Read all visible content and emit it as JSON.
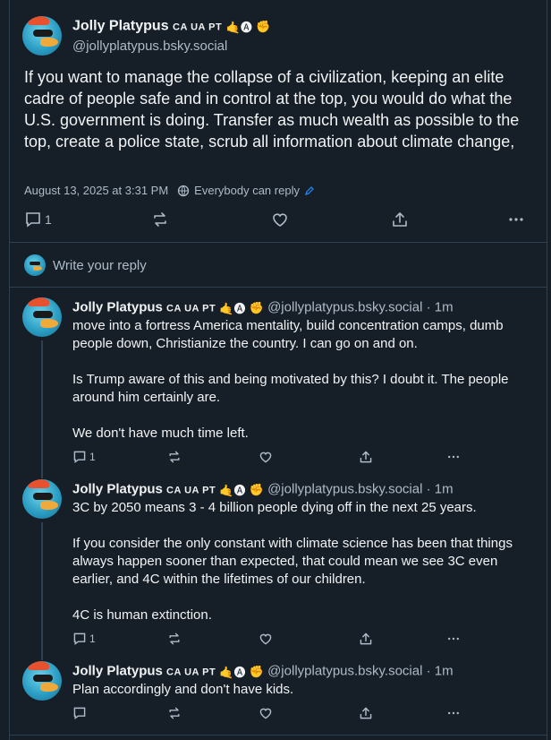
{
  "post": {
    "author_name": "Jolly Platypus",
    "flags": "CA UA PT",
    "handle": "@jollyplatypus.bsky.social",
    "text": "If you want to manage the collapse of a civilization, keeping an elite cadre of people safe and in control at the top, you would do what the U.S. government is doing. Transfer as much  wealth  as possible to the top, create a police state, scrub all information about climate change,",
    "timestamp": "August 13, 2025 at 3:31 PM",
    "reply_setting": "Everybody can reply",
    "reply_count": "1"
  },
  "composer": {
    "placeholder": "Write your reply"
  },
  "replies": [
    {
      "author_name": "Jolly Platypus",
      "flags": "CA UA PT",
      "handle": "@jollyplatypus.bsky.social",
      "time": "· 1m",
      "paragraphs": [
        "move into a fortress America mentality, build concentration camps, dumb people down, Christianize the country. I can go on and on.",
        "Is Trump aware of this and being motivated by this? I doubt it. The people around him certainly are.",
        "We don't have much time left."
      ],
      "reply_count": "1"
    },
    {
      "author_name": "Jolly Platypus",
      "flags": "CA UA PT",
      "handle": "@jollyplatypus.bsky.social",
      "time": "· 1m",
      "paragraphs": [
        "3C by 2050 means 3 - 4 billion people dying off in the next 25 years.",
        "If you consider the only constant with climate science has been that things always happen sooner than expected, that could mean we see 3C even earlier, and 4C within the lifetimes of our children.",
        "4C is human extinction."
      ],
      "reply_count": "1"
    },
    {
      "author_name": "Jolly Platypus",
      "flags": "CA UA PT",
      "handle": "@jollyplatypus.bsky.social",
      "time": "· 1m",
      "paragraphs": [
        "Plan accordingly and don't have kids."
      ],
      "reply_count": ""
    }
  ],
  "icons": {
    "reply": "reply-icon",
    "repost": "repost-icon",
    "like": "like-icon",
    "share": "share-icon",
    "more": "more-icon",
    "globe": "globe-icon",
    "edit": "pencil-icon"
  },
  "colors": {
    "background": "#161e27",
    "border": "#2e4052",
    "muted": "#aebbc9",
    "link": "#208bfe"
  }
}
